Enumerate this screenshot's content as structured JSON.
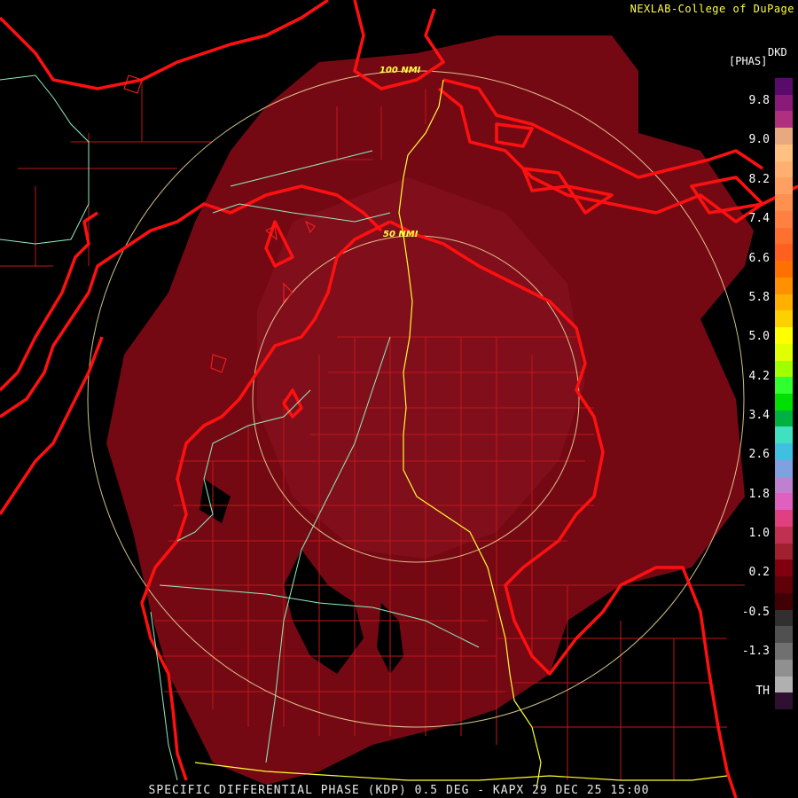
{
  "credit": "NEXLAB-College of DuPage",
  "footer": "SPECIFIC DIFFERENTIAL PHASE (KDP) 0.5 DEG - KAPX 29 DEC 25 15:00",
  "legend": {
    "units": "[PHAS]",
    "product": "DKD",
    "ticks": [
      "9.8",
      "9.0",
      "8.2",
      "7.4",
      "6.6",
      "5.8",
      "5.0",
      "4.2",
      "3.4",
      "2.6",
      "1.8",
      "1.0",
      "0.2",
      "-0.5",
      "-1.3",
      "TH"
    ],
    "colors": [
      "#5a0a6a",
      "#8a1a7a",
      "#b03080",
      "#e8a880",
      "#ffc080",
      "#ffb070",
      "#ffa060",
      "#ff9050",
      "#ff8040",
      "#ff7030",
      "#ff6020",
      "#ff7000",
      "#ff9000",
      "#ffb000",
      "#ffd000",
      "#ffff00",
      "#e0ff00",
      "#a0ff00",
      "#30ff30",
      "#00e000",
      "#00b040",
      "#40e0c0",
      "#40c0e0",
      "#80a0e0",
      "#c080d0",
      "#e060c0",
      "#e04080",
      "#c03050",
      "#a02030",
      "#800010",
      "#600008",
      "#400004",
      "#303030",
      "#505050",
      "#707070",
      "#909090",
      "#b0b0b0",
      "#301030"
    ]
  },
  "range_rings": [
    "100 NMI",
    "50 NMI"
  ],
  "colors": {
    "echo": "#7a0a14",
    "border": "#ff1010",
    "county": "#c01818",
    "road_yellow": "#ffff30",
    "road_green": "#8ff0c0",
    "ring": "#f5e0a0"
  }
}
